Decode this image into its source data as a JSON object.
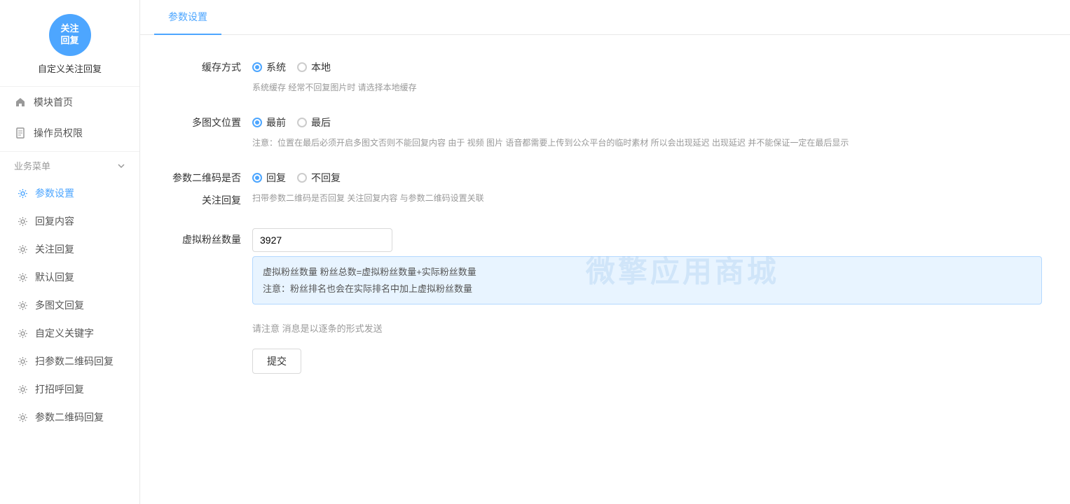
{
  "sidebar": {
    "logo_text": "关注\n回复",
    "app_title": "自定义关注回复",
    "nav_items": [
      {
        "id": "home",
        "label": "模块首页",
        "icon": "home"
      },
      {
        "id": "permissions",
        "label": "操作员权限",
        "icon": "doc"
      }
    ],
    "section_title": "业务菜单",
    "menu_items": [
      {
        "id": "params",
        "label": "参数设置",
        "active": true
      },
      {
        "id": "reply-content",
        "label": "回复内容",
        "active": false
      },
      {
        "id": "follow-reply",
        "label": "关注回复",
        "active": false
      },
      {
        "id": "default-reply",
        "label": "默认回复",
        "active": false
      },
      {
        "id": "multi-reply",
        "label": "多图文回复",
        "active": false
      },
      {
        "id": "custom-keyword",
        "label": "自定义关键字",
        "active": false
      },
      {
        "id": "scan-qr-reply",
        "label": "扫参数二维码回复",
        "active": false
      },
      {
        "id": "greeting-reply",
        "label": "打招呼回复",
        "active": false
      },
      {
        "id": "param-qr-reply",
        "label": "参数二维码回复",
        "active": false
      }
    ]
  },
  "tab": {
    "label": "参数设置"
  },
  "form": {
    "cache_label": "缓存方式",
    "cache_options": [
      "系统",
      "本地"
    ],
    "cache_selected": "系统",
    "cache_hint": "系统缓存 经常不回复图片时 请选择本地缓存",
    "multiimg_label": "多图文位置",
    "multiimg_options": [
      "最前",
      "最后"
    ],
    "multiimg_selected": "最前",
    "multiimg_hint": "注意：位置在最后必须开启多图文否则不能回复内容 由于 视频 图片 语音都需要上传到公众平台的临时素材 所以会出现延迟 出现延迟 并不能保证一定在最后显示",
    "qrcode_label": "参数二维码是否关注回复",
    "qrcode_options": [
      "回复",
      "不回复"
    ],
    "qrcode_selected": "回复",
    "qrcode_hint": "扫带参数二维码是否回复 关注回复内容 与参数二维码设置关联",
    "fans_label": "虚拟粉丝数量",
    "fans_value": "3927",
    "fans_info_line1": "虚拟粉丝数量 粉丝总数=虚拟粉丝数量+实际粉丝数量",
    "fans_info_line2": "注意：粉丝排名也会在实际排名中加上虚拟粉丝数量",
    "notice": "请注意 消息是以逐条的形式发送",
    "submit_label": "提交"
  },
  "watermark": "微擎应用商城"
}
